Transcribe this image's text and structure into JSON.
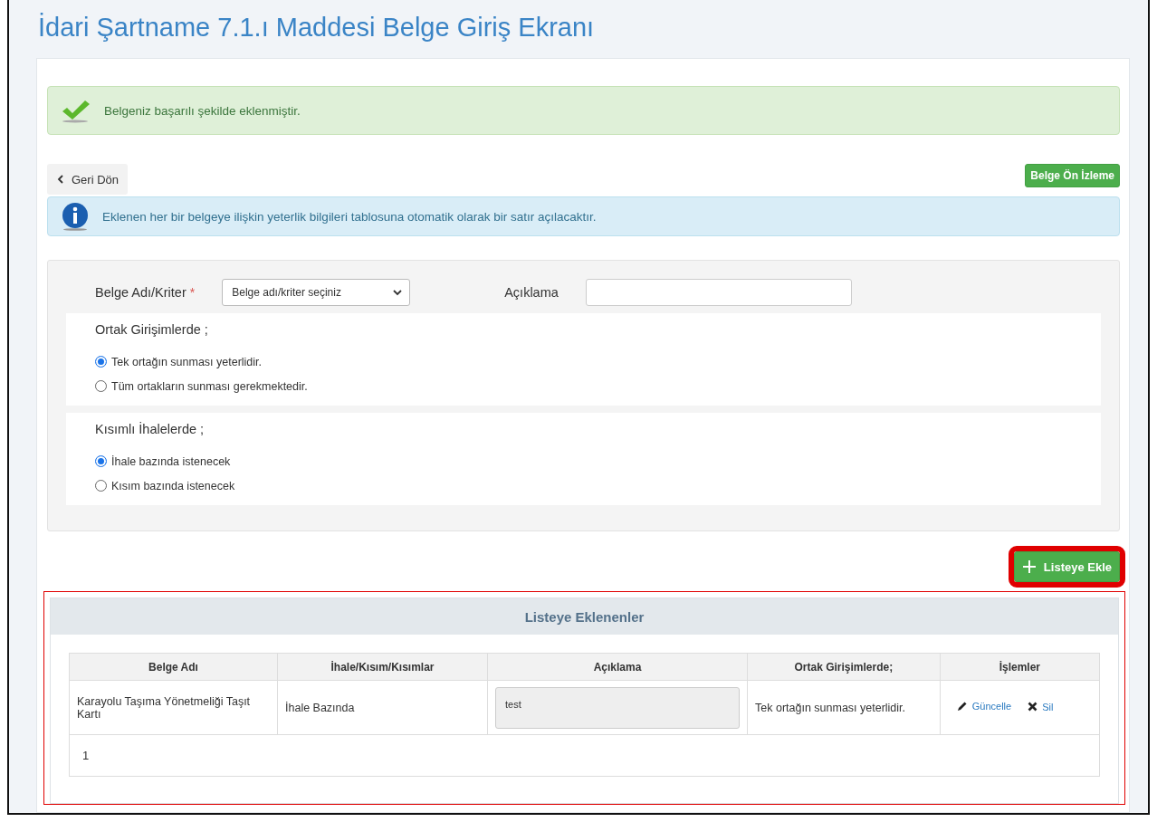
{
  "page_title": "İdari Şartname 7.1.ı Maddesi Belge Giriş Ekranı",
  "success_alert": {
    "text": "Belgeniz başarılı şekilde eklenmiştir."
  },
  "back_button": {
    "label": "Geri Dön"
  },
  "preview_button": {
    "label": "Belge Ön İzleme"
  },
  "info_alert": {
    "text": "Eklenen her bir belgeye ilişkin yeterlik bilgileri tablosuna otomatik olarak bir satır açılacaktır."
  },
  "form": {
    "criteria_label": "Belge Adı/Kriter",
    "required_mark": "*",
    "criteria_select": {
      "value": "Belge adı/kriter seçiniz"
    },
    "description_label": "Açıklama",
    "groups": [
      {
        "title": "Ortak Girişimlerde ;",
        "options": [
          {
            "label": "Tek ortağın sunması yeterlidir.",
            "selected": true
          },
          {
            "label": "Tüm ortakların sunması gerekmektedir.",
            "selected": false
          }
        ]
      },
      {
        "title": "Kısımlı İhalelerde ;",
        "options": [
          {
            "label": "İhale bazında istenecek",
            "selected": true
          },
          {
            "label": "Kısım bazında istenecek",
            "selected": false
          }
        ]
      }
    ]
  },
  "add_button": {
    "label": "Listeye Ekle",
    "highlighted": true
  },
  "list_panel": {
    "title": "Listeye Eklenenler",
    "highlighted": true,
    "columns": [
      "Belge Adı",
      "İhale/Kısım/Kısımlar",
      "Açıklama",
      "Ortak Girişimlerde;",
      "İşlemler"
    ],
    "rows": [
      {
        "name": "Karayolu Taşıma Yönetmeliği Taşıt Kartı",
        "scope": "İhale Bazında",
        "description": "test",
        "joint": "Tek ortağın sunması yeterlidir.",
        "actions": [
          {
            "kind": "edit",
            "label": "Güncelle"
          },
          {
            "kind": "delete",
            "label": "Sil"
          }
        ]
      }
    ],
    "pagination": [
      "1"
    ]
  }
}
